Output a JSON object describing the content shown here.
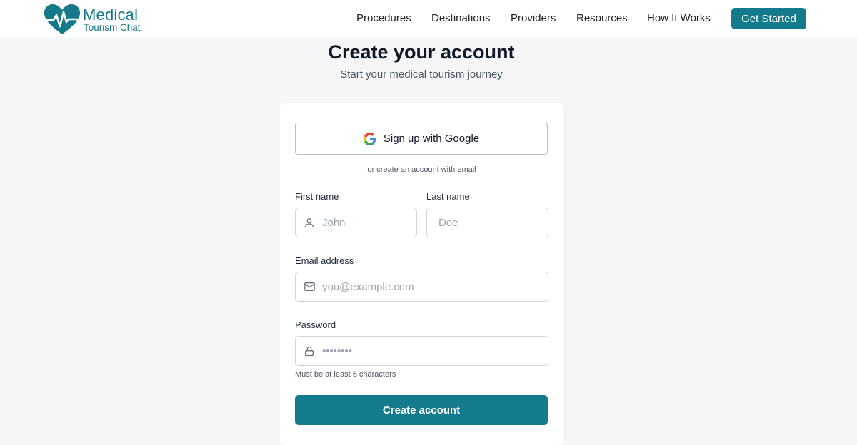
{
  "brand": {
    "name": "Medical",
    "tagline": "Tourism Chat",
    "color": "#147a8a",
    "logo_icon": "heart-pulse-icon"
  },
  "nav": {
    "items": [
      "Procedures",
      "Destinations",
      "Providers",
      "Resources",
      "How It Works"
    ],
    "cta_label": "Get Started"
  },
  "page": {
    "title": "Create your account",
    "subtitle": "Start your medical tourism journey"
  },
  "form": {
    "google_label": "Sign up with Google",
    "divider_text": "or create an account with email",
    "first_name": {
      "label": "First name",
      "placeholder": "John",
      "icon": "user-icon"
    },
    "last_name": {
      "label": "Last name",
      "placeholder": "Doe"
    },
    "email": {
      "label": "Email address",
      "placeholder": "you@example.com",
      "icon": "mail-icon"
    },
    "password": {
      "label": "Password",
      "placeholder": "••••••••",
      "icon": "lock-icon",
      "hint": "Must be at least 6 characters"
    },
    "submit_label": "Create account"
  },
  "colors": {
    "accent": "#137b8b",
    "background": "#f4f6f8"
  }
}
